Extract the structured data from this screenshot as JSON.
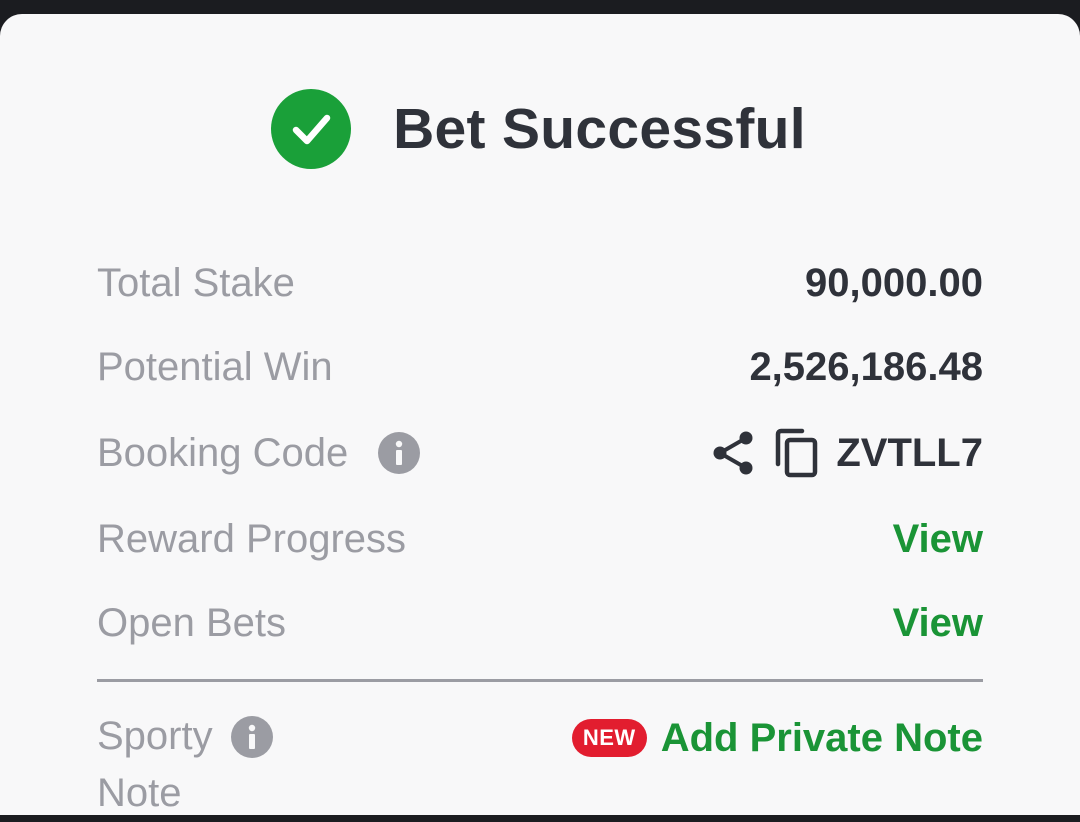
{
  "header": {
    "title": "Bet Successful",
    "icon": "check-circle-icon"
  },
  "details": {
    "total_stake": {
      "label": "Total Stake",
      "value": "90,000.00"
    },
    "potential_win": {
      "label": "Potential Win",
      "value": "2,526,186.48"
    },
    "booking_code": {
      "label": "Booking Code",
      "value": "ZVTLL7"
    },
    "reward_progress": {
      "label": "Reward Progress",
      "action": "View"
    },
    "open_bets": {
      "label": "Open Bets",
      "action": "View"
    }
  },
  "sporty_note": {
    "label_line1": "Sporty",
    "label_line2": "Note",
    "badge": "NEW",
    "action": "Add Private Note"
  },
  "colors": {
    "success_green": "#1aa039",
    "link_green": "#1a9436",
    "badge_red": "#e21d2f",
    "text_dark": "#2f323a",
    "text_muted": "#9b9ca3"
  }
}
